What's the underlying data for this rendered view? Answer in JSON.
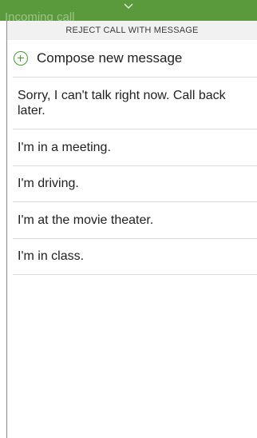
{
  "status_bar": {
    "title": "Incoming call",
    "background": "#5a9a3c"
  },
  "dialog": {
    "header": "REJECT CALL WITH MESSAGE",
    "compose": {
      "label": "Compose new message",
      "icon": "plus-circle-icon",
      "accent": "#4a9a3a"
    },
    "messages": [
      "Sorry, I can't talk right now. Call back later.",
      "I'm in a meeting.",
      "I'm driving.",
      "I'm at the movie theater.",
      "I'm in class."
    ]
  }
}
